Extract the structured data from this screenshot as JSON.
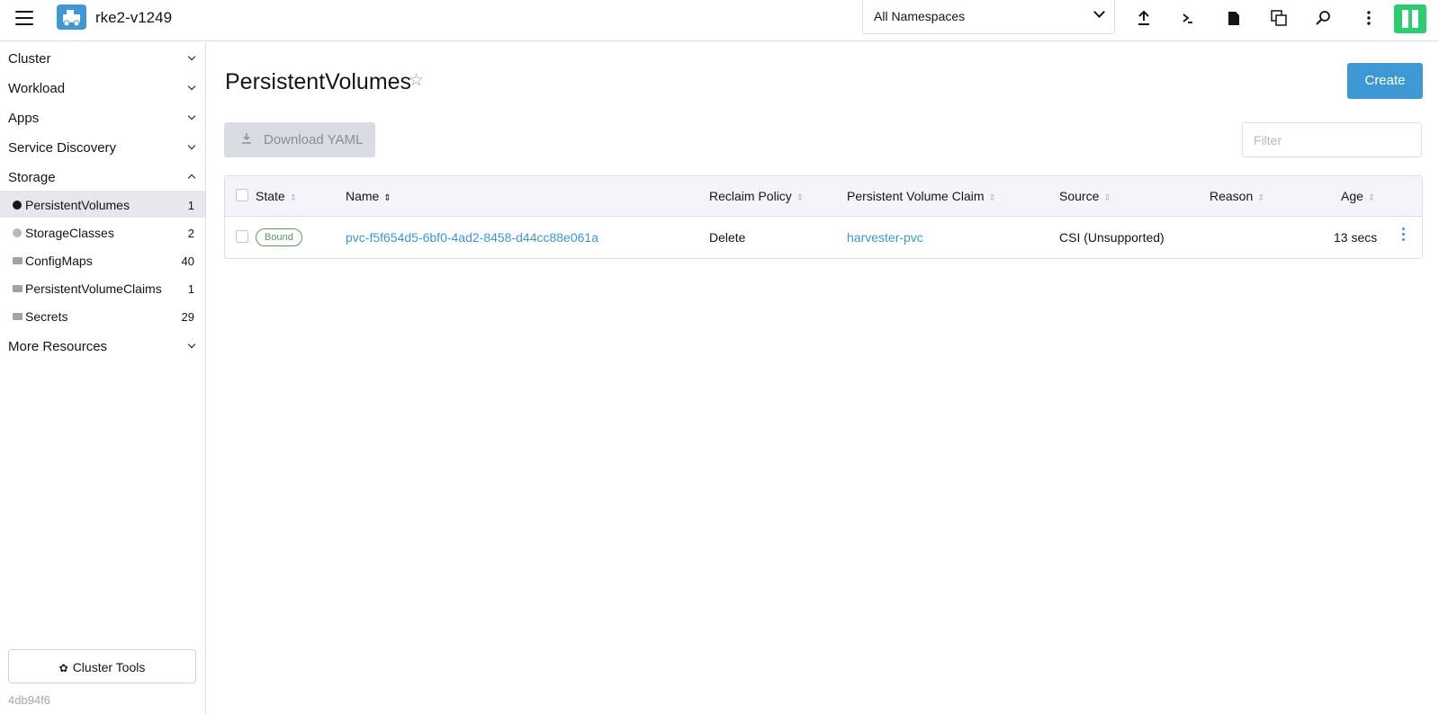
{
  "header": {
    "cluster_name": "rke2-v1249",
    "namespace_select": "All Namespaces",
    "icons": [
      "upload-icon",
      "terminal-icon",
      "file-icon",
      "copy-icon",
      "search-icon",
      "more-vertical-icon"
    ]
  },
  "sidebar": {
    "groups": [
      {
        "label": "Cluster",
        "expanded": false
      },
      {
        "label": "Workload",
        "expanded": false
      },
      {
        "label": "Apps",
        "expanded": false
      },
      {
        "label": "Service Discovery",
        "expanded": false
      },
      {
        "label": "Storage",
        "expanded": true
      },
      {
        "label": "More Resources",
        "expanded": false
      }
    ],
    "storage_items": [
      {
        "label": "PersistentVolumes",
        "count": "1",
        "active": true
      },
      {
        "label": "StorageClasses",
        "count": "2"
      },
      {
        "label": "ConfigMaps",
        "count": "40"
      },
      {
        "label": "PersistentVolumeClaims",
        "count": "1"
      },
      {
        "label": "Secrets",
        "count": "29"
      }
    ],
    "cluster_tools": "Cluster Tools",
    "version": "4db94f6"
  },
  "main": {
    "title": "PersistentVolumes",
    "create_label": "Create",
    "download_label": "Download YAML",
    "filter_placeholder": "Filter",
    "columns": [
      "State",
      "Name",
      "Reclaim Policy",
      "Persistent Volume Claim",
      "Source",
      "Reason",
      "Age"
    ],
    "rows": [
      {
        "state": "Bound",
        "name": "pvc-f5f654d5-6bf0-4ad2-8458-d44cc88e061a",
        "reclaim_policy": "Delete",
        "pvc": "harvester-pvc",
        "source": "CSI (Unsupported)",
        "reason": "",
        "age": "13 secs"
      }
    ]
  },
  "colors": {
    "accent": "#3d98d3",
    "bound": "#5d995d",
    "rancher_green": "#2ecc71"
  }
}
